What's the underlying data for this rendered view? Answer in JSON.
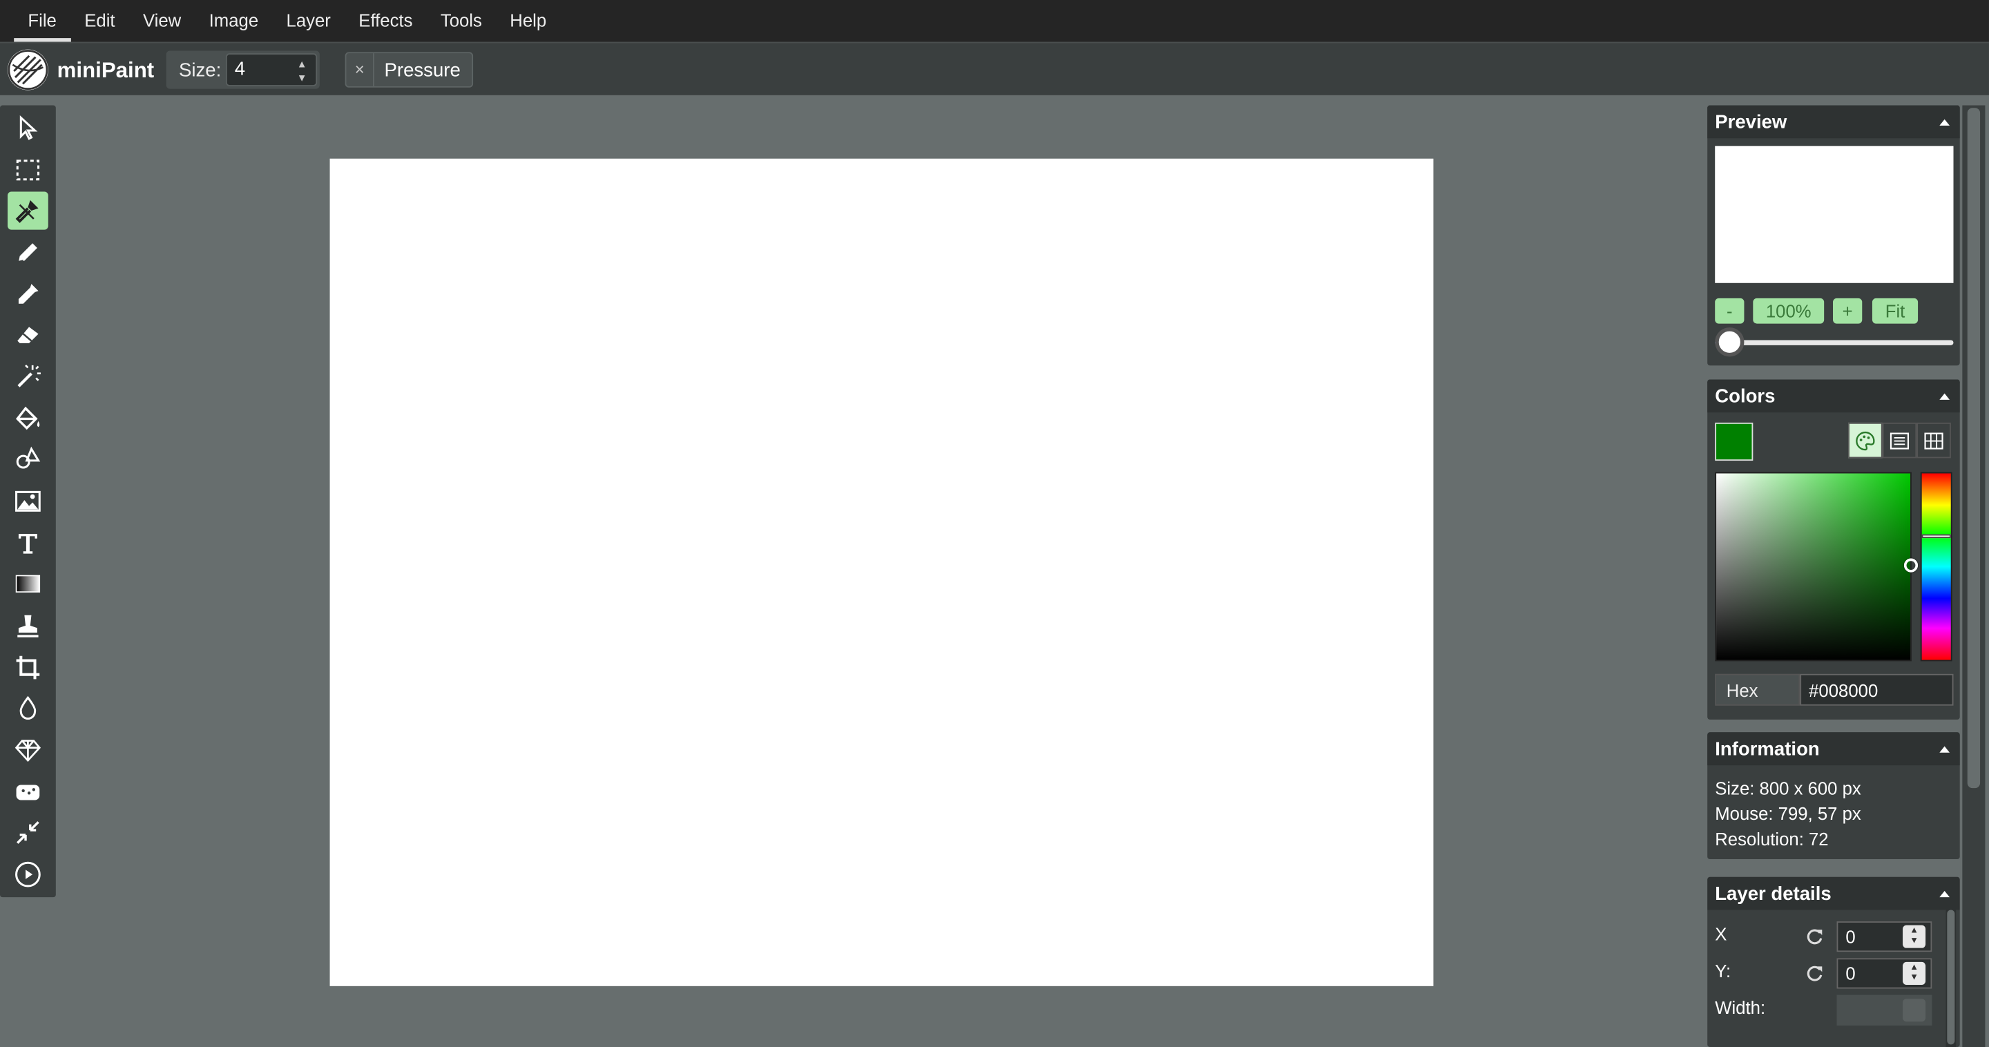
{
  "menu": [
    "File",
    "Edit",
    "View",
    "Image",
    "Layer",
    "Effects",
    "Tools",
    "Help"
  ],
  "app": {
    "name": "miniPaint"
  },
  "toolbar": {
    "size_label": "Size:",
    "size_value": "4",
    "pressure_label": "Pressure",
    "pressure_close": "×"
  },
  "tools": [
    {
      "name": "select-tool",
      "icon": "pointer-icon",
      "active": false
    },
    {
      "name": "selection-tool",
      "icon": "dashed-rectangle-icon",
      "active": false
    },
    {
      "name": "brush-tool",
      "icon": "brush-icon",
      "active": true
    },
    {
      "name": "pencil-tool",
      "icon": "pencil-icon",
      "active": false
    },
    {
      "name": "pick-color-tool",
      "icon": "eyedropper-icon",
      "active": false
    },
    {
      "name": "erase-tool",
      "icon": "eraser-icon",
      "active": false
    },
    {
      "name": "magic-wand-tool",
      "icon": "magic-wand-icon",
      "active": false
    },
    {
      "name": "fill-tool",
      "icon": "paint-bucket-icon",
      "active": false
    },
    {
      "name": "shape-tool",
      "icon": "shapes-icon",
      "active": false
    },
    {
      "name": "media-tool",
      "icon": "image-icon",
      "active": false
    },
    {
      "name": "text-tool",
      "icon": "text-icon",
      "active": false
    },
    {
      "name": "gradient-tool",
      "icon": "gradient-icon",
      "active": false
    },
    {
      "name": "clone-tool",
      "icon": "stamp-icon",
      "active": false
    },
    {
      "name": "crop-tool",
      "icon": "crop-icon",
      "active": false
    },
    {
      "name": "blur-tool",
      "icon": "drop-icon",
      "active": false
    },
    {
      "name": "sharpen-tool",
      "icon": "diamond-icon",
      "active": false
    },
    {
      "name": "desaturate-tool",
      "icon": "sponge-icon",
      "active": false
    },
    {
      "name": "bulge-pinch-tool",
      "icon": "compress-icon",
      "active": false
    },
    {
      "name": "animation-tool",
      "icon": "play-circle-icon",
      "active": false
    }
  ],
  "preview": {
    "title": "Preview",
    "zoom_minus": "-",
    "zoom_value": "100%",
    "zoom_plus": "+",
    "fit": "Fit",
    "zoom_slider_fraction": 0.02
  },
  "colors": {
    "title": "Colors",
    "current": "#008000",
    "hex_label": "Hex",
    "hex_value": "#008000",
    "modes": [
      "palette-icon",
      "list-icon",
      "grid-icon"
    ]
  },
  "information": {
    "title": "Information",
    "size": "Size: 800 x 600 px",
    "mouse": "Mouse: 799, 57 px",
    "resolution": "Resolution: 72"
  },
  "layer_details": {
    "title": "Layer details",
    "x_label": "X",
    "x_value": "0",
    "y_label": "Y:",
    "y_value": "0",
    "width_label": "Width:",
    "width_value": ""
  }
}
